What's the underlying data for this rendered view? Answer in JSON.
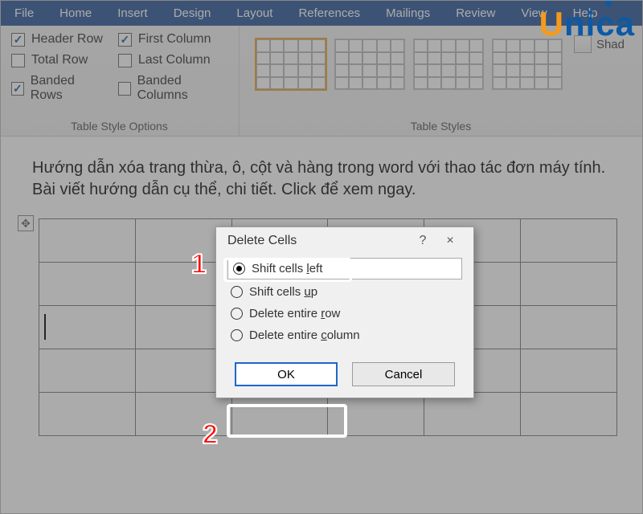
{
  "menubar": {
    "items": [
      "File",
      "Home",
      "Insert",
      "Design",
      "Layout",
      "References",
      "Mailings",
      "Review",
      "View",
      "Help"
    ]
  },
  "ribbon": {
    "style_options": {
      "label": "Table Style Options",
      "left": [
        {
          "label": "Header Row",
          "checked": true
        },
        {
          "label": "Total Row",
          "checked": false
        },
        {
          "label": "Banded Rows",
          "checked": true
        }
      ],
      "right": [
        {
          "label": "First Column",
          "checked": true
        },
        {
          "label": "Last Column",
          "checked": false
        },
        {
          "label": "Banded Columns",
          "checked": false
        }
      ]
    },
    "table_styles": {
      "label": "Table Styles"
    },
    "shading": {
      "label": "Shad"
    }
  },
  "document": {
    "paragraph": "Hướng dẫn xóa trang thừa, ô, cột và hàng trong word với thao tác đơn máy tính. Bài viết hướng dẫn cụ thể, chi tiết. Click để xem ngay."
  },
  "dialog": {
    "title": "Delete Cells",
    "options": [
      {
        "pre": "Shift cells ",
        "ul": "l",
        "post": "eft",
        "selected": true
      },
      {
        "pre": "Shift cells ",
        "ul": "u",
        "post": "p",
        "selected": false
      },
      {
        "pre": "Delete entire ",
        "ul": "r",
        "post": "ow",
        "selected": false
      },
      {
        "pre": "Delete entire ",
        "ul": "c",
        "post": "olumn",
        "selected": false
      }
    ],
    "ok": "OK",
    "cancel": "Cancel",
    "help": "?",
    "close": "×"
  },
  "annotations": {
    "one": "1",
    "two": "2"
  },
  "watermark": {
    "u": "U",
    "rest": "nica"
  }
}
